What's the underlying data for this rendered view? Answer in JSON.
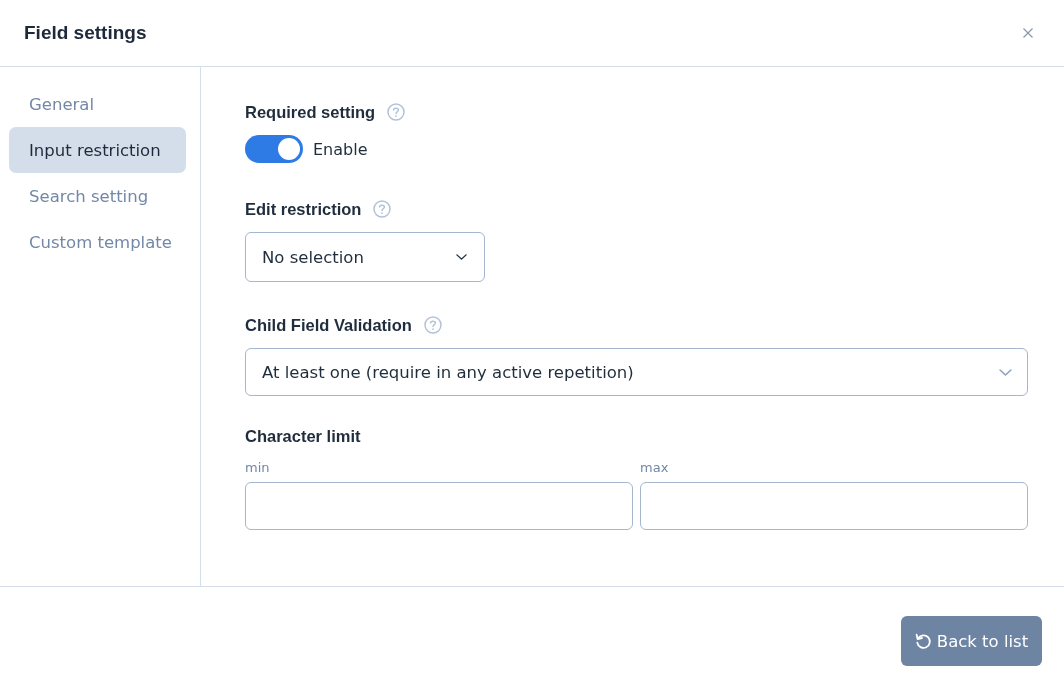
{
  "dialog": {
    "title": "Field settings"
  },
  "sidebar": {
    "items": [
      {
        "label": "General",
        "selected": false
      },
      {
        "label": "Input restriction",
        "selected": true
      },
      {
        "label": "Search setting",
        "selected": false
      },
      {
        "label": "Custom template",
        "selected": false
      }
    ]
  },
  "settings": [
    {
      "kind": "toggle",
      "label": "Required setting",
      "help": true,
      "on": true,
      "toggle_label": "Enable"
    },
    {
      "kind": "dropdown",
      "label": "Edit restriction",
      "help": true,
      "value": "No selection"
    },
    {
      "kind": "select",
      "label": "Child Field Validation",
      "help": true,
      "value": "At least one (require in any active repetition)"
    },
    {
      "kind": "range",
      "label": "Character limit",
      "help": false,
      "fields": [
        {
          "label": "min"
        },
        {
          "label": "max"
        }
      ]
    }
  ],
  "footer": {
    "button": {
      "label": "Back to list"
    }
  }
}
